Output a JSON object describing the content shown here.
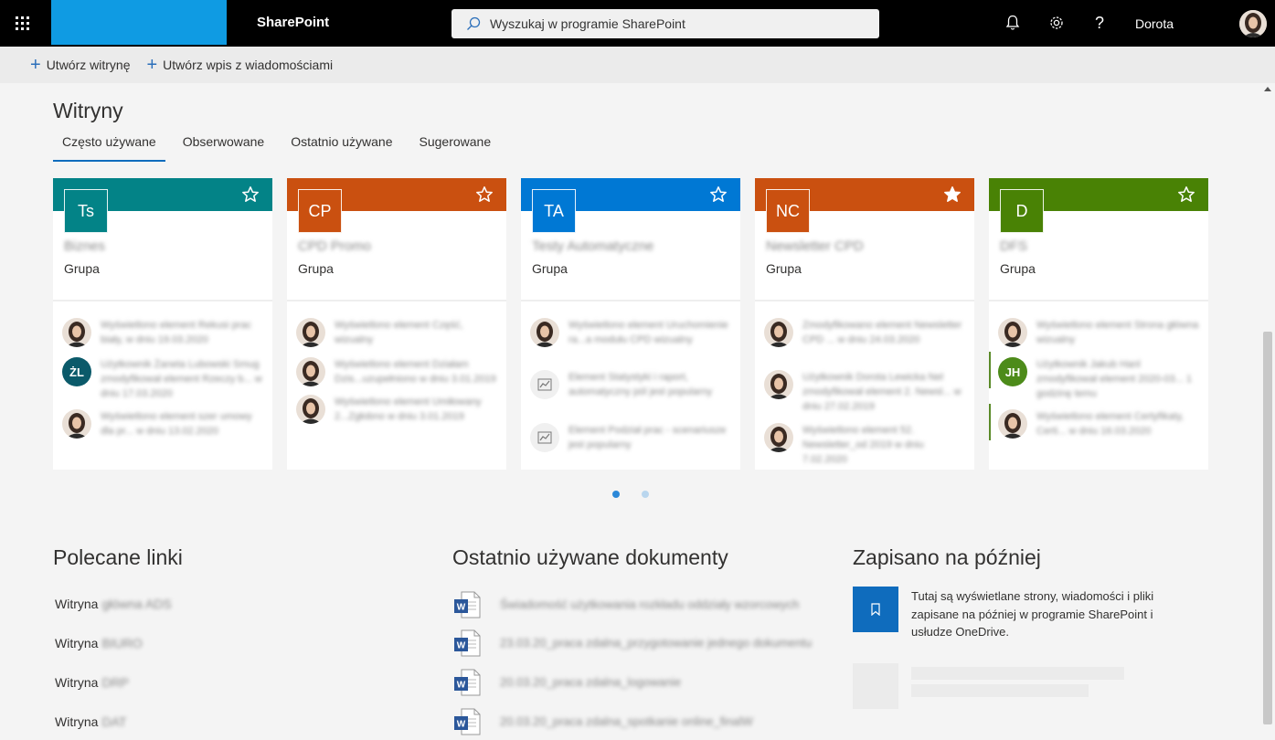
{
  "topbar": {
    "app_name": "SharePoint",
    "search_placeholder": "Wyszukaj w programie SharePoint",
    "user_name": "Dorota"
  },
  "commands": [
    {
      "label": "Utwórz witrynę"
    },
    {
      "label": "Utwórz wpis z wiadomościami"
    }
  ],
  "sites": {
    "title": "Witryny",
    "tabs": [
      "Często używane",
      "Obserwowane",
      "Ostatnio używane",
      "Sugerowane"
    ],
    "active_tab": 0,
    "cards": [
      {
        "initials": "Ts",
        "name": "Biznes",
        "type": "Grupa",
        "color": "#038387",
        "starred": false,
        "activities": [
          {
            "icon": "avatar",
            "text": "Wyświetlono element Rekusi prac biały, w dniu 19.03.2020"
          },
          {
            "icon": "initials",
            "initials": "ŻL",
            "text": "Użytkownik Żaneta Lubowski Smug zmodyfikował element Rzeczy b... w dniu 17.03.2020"
          },
          {
            "icon": "avatar",
            "text": "Wyświetlono element szer umowy dla pr... w dniu 13.02.2020"
          }
        ]
      },
      {
        "initials": "CP",
        "name": "CPD Promo",
        "type": "Grupa",
        "color": "#ca5010",
        "starred": false,
        "activities": [
          {
            "icon": "avatar",
            "text": "Wyświetlono element Część, wizualny"
          },
          {
            "icon": "avatar",
            "text": "Wyświetlono element Działam Dzis...uzupełniono w dniu 3.01.2019"
          },
          {
            "icon": "avatar",
            "text": "Wyświetlono element Umiłowany 2...Zgłobno w dniu 3.01.2019"
          }
        ]
      },
      {
        "initials": "TA",
        "name": "Testy Automatyczne",
        "type": "Grupa",
        "color": "#0078d4",
        "starred": false,
        "activities": [
          {
            "icon": "avatar",
            "text": "Wyświetlono element Uruchomienie ra...a modułu CPD wizualny"
          },
          {
            "icon": "chart",
            "text": "Element Statystyki i raport, automatyczny pól jest popularny"
          },
          {
            "icon": "chart",
            "text": "Element Podział prac - scenariusze jest popularny"
          }
        ]
      },
      {
        "initials": "NC",
        "name": "Newsletter CPD",
        "type": "Grupa",
        "color": "#ca5010",
        "starred": true,
        "activities": [
          {
            "icon": "avatar",
            "text": "Zmodyfikowano element Newsletter CPD ... w dniu 24.03.2020"
          },
          {
            "icon": "avatar",
            "text": "Użytkownik Dorota Lewicka Nel zmodyfikował element 2. Newsl... w dniu 27.02.2019"
          },
          {
            "icon": "avatar",
            "text": "Wyświetlono element 52. Newsletter_od 2019 w dniu 7.02.2020"
          }
        ]
      },
      {
        "initials": "D",
        "name": "DFS",
        "type": "Grupa",
        "color": "#498205",
        "starred": false,
        "activities": [
          {
            "icon": "avatar",
            "text": "Wyświetlono element Strona główna wizualny"
          },
          {
            "icon": "initials",
            "initials": "JH",
            "text": "Użytkownik Jakub Hanl zmodyfikował element 2020-03... 1 godzinę temu",
            "bar": true
          },
          {
            "icon": "avatar",
            "text": "Wyświetlono element Certyfikaty, Certi... w dniu 16.03.2020",
            "bar": true
          }
        ]
      }
    ]
  },
  "links": {
    "title": "Polecane linki",
    "items": [
      {
        "prefix": "Witryna",
        "name": "główna ADS"
      },
      {
        "prefix": "Witryna",
        "name": "BIURO"
      },
      {
        "prefix": "Witryna",
        "name": "DRP"
      },
      {
        "prefix": "Witryna",
        "name": "DAT"
      }
    ]
  },
  "docs": {
    "title": "Ostatnio używane dokumenty",
    "items": [
      {
        "name": "Świadomość użytkowania rozkładu oddziały wzorcowych"
      },
      {
        "name": "23.03.20_praca zdalna_przygotowanie jednego dokumentu"
      },
      {
        "name": "20.03.20_praca zdalna_logowanie"
      },
      {
        "name": "20.03.20_praca zdalna_spotkanie online_finalW"
      }
    ]
  },
  "saved": {
    "title": "Zapisano na później",
    "text": "Tutaj są wyświetlane strony, wiadomości i pliki zapisane na później w programie SharePoint i usłudze OneDrive."
  }
}
